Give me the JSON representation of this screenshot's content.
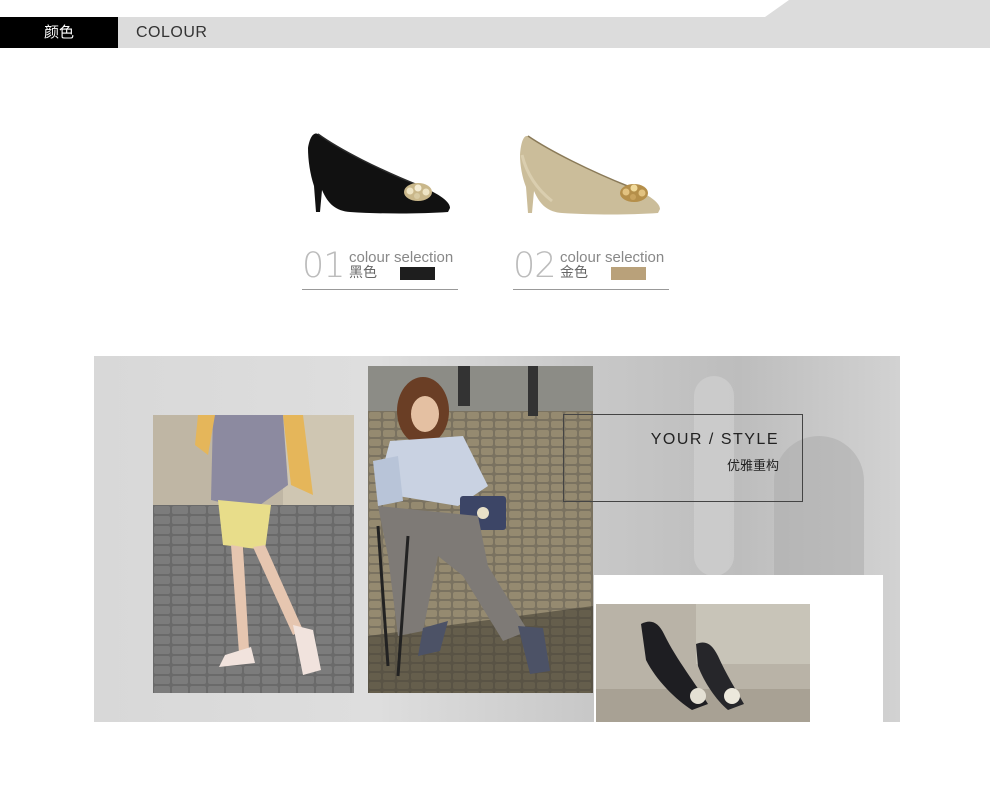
{
  "header": {
    "label_cn": "颜色",
    "label_en": "COLOUR"
  },
  "colours": [
    {
      "number": "01",
      "caption_en": "colour selection",
      "name_cn": "黑色",
      "swatch": "#1e1e1e",
      "shoe_color": "#111111"
    },
    {
      "number": "02",
      "caption_en": "colour selection",
      "name_cn": "金色",
      "swatch": "#b9a17a",
      "shoe_color": "#cbbd9a"
    }
  ],
  "style_box": {
    "title_en": "YOUR / STYLE",
    "subtitle_cn": "优雅重构"
  },
  "photos": [
    {
      "name": "street-walk-photo"
    },
    {
      "name": "seated-model-photo"
    },
    {
      "name": "shoe-closeup-photo"
    }
  ],
  "colors": {
    "header_bg": "#dcdcdc",
    "header_label_bg": "#000000",
    "section_bg": "#d8d8d8"
  }
}
